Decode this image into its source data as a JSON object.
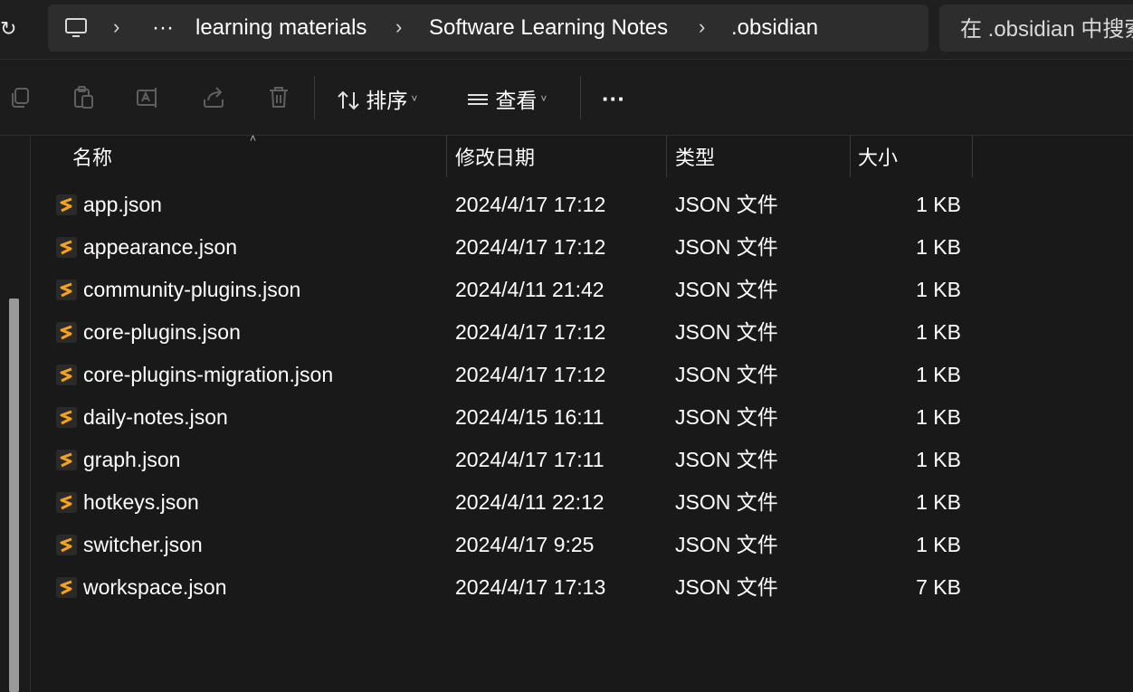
{
  "address": {
    "more": "···",
    "crumbs": [
      "learning materials",
      "Software Learning Notes",
      ".obsidian"
    ]
  },
  "search": {
    "placeholder": "在 .obsidian 中搜索"
  },
  "toolbar": {
    "sort_label": "排序",
    "view_label": "查看",
    "more": "···"
  },
  "columns": {
    "name": "名称",
    "modified": "修改日期",
    "type": "类型",
    "size": "大小"
  },
  "files": [
    {
      "name": "app.json",
      "modified": "2024/4/17 17:12",
      "type": "JSON 文件",
      "size": "1 KB"
    },
    {
      "name": "appearance.json",
      "modified": "2024/4/17 17:12",
      "type": "JSON 文件",
      "size": "1 KB"
    },
    {
      "name": "community-plugins.json",
      "modified": "2024/4/11 21:42",
      "type": "JSON 文件",
      "size": "1 KB"
    },
    {
      "name": "core-plugins.json",
      "modified": "2024/4/17 17:12",
      "type": "JSON 文件",
      "size": "1 KB"
    },
    {
      "name": "core-plugins-migration.json",
      "modified": "2024/4/17 17:12",
      "type": "JSON 文件",
      "size": "1 KB"
    },
    {
      "name": "daily-notes.json",
      "modified": "2024/4/15 16:11",
      "type": "JSON 文件",
      "size": "1 KB"
    },
    {
      "name": "graph.json",
      "modified": "2024/4/17 17:11",
      "type": "JSON 文件",
      "size": "1 KB"
    },
    {
      "name": "hotkeys.json",
      "modified": "2024/4/11 22:12",
      "type": "JSON 文件",
      "size": "1 KB"
    },
    {
      "name": "switcher.json",
      "modified": "2024/4/17 9:25",
      "type": "JSON 文件",
      "size": "1 KB"
    },
    {
      "name": "workspace.json",
      "modified": "2024/4/17 17:13",
      "type": "JSON 文件",
      "size": "7 KB"
    }
  ],
  "colors": {
    "file_icon_accent": "#f7a21b",
    "background": "#191919"
  }
}
